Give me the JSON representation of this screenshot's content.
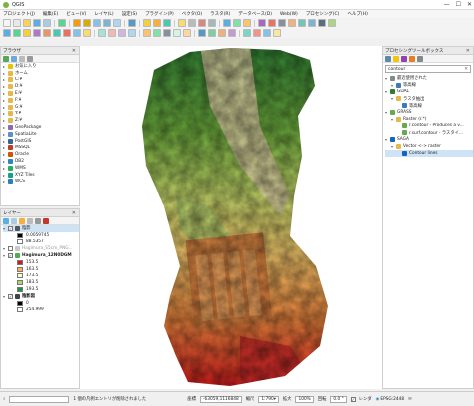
{
  "window": {
    "title": "QGIS"
  },
  "menu": [
    "プロジェクト(J)",
    "編集(E)",
    "ビュー(V)",
    "レイヤ(L)",
    "設定(S)",
    "プラグイン(P)",
    "ベクタ(O)",
    "ラスタ(R)",
    "データベース(D)",
    "Web(W)",
    "プロセシング(C)",
    "ヘルプ(H)"
  ],
  "browser": {
    "title": "ブラウザ",
    "items": [
      {
        "label": "お気に入り",
        "icon": "star-icon",
        "color": "#e8c400",
        "indent": 0
      },
      {
        "label": "ホーム",
        "icon": "folder-icon",
        "color": "#e6b84a",
        "indent": 0
      },
      {
        "label": "C:¥",
        "icon": "folder-icon",
        "color": "#e6b84a",
        "indent": 0
      },
      {
        "label": "D:¥",
        "icon": "folder-icon",
        "color": "#e6b84a",
        "indent": 0
      },
      {
        "label": "E:¥",
        "icon": "folder-icon",
        "color": "#e6b84a",
        "indent": 0
      },
      {
        "label": "F:¥",
        "icon": "folder-icon",
        "color": "#e6b84a",
        "indent": 0
      },
      {
        "label": "G:¥",
        "icon": "folder-icon",
        "color": "#e6b84a",
        "indent": 0
      },
      {
        "label": "Y:¥",
        "icon": "folder-icon",
        "color": "#e6b84a",
        "indent": 0
      },
      {
        "label": "Z:¥",
        "icon": "folder-icon",
        "color": "#e6b84a",
        "indent": 0
      },
      {
        "label": "GeoPackage",
        "icon": "geopackage-icon",
        "color": "#8c6bb1",
        "indent": 0
      },
      {
        "label": "SpatiaLite",
        "icon": "spatialite-icon",
        "color": "#5b8fd0",
        "indent": 0
      },
      {
        "label": "PostGIS",
        "icon": "postgis-icon",
        "color": "#336791",
        "indent": 0
      },
      {
        "label": "MSSQL",
        "icon": "mssql-icon",
        "color": "#c0392b",
        "indent": 0
      },
      {
        "label": "Oracle",
        "icon": "oracle-icon",
        "color": "#d35400",
        "indent": 0
      },
      {
        "label": "DB2",
        "icon": "db2-icon",
        "color": "#2e86c1",
        "indent": 0
      },
      {
        "label": "WMS",
        "icon": "wms-icon",
        "color": "#27ae60",
        "indent": 0
      },
      {
        "label": "XYZ Tiles",
        "icon": "xyz-tiles-icon",
        "color": "#16a085",
        "indent": 0
      },
      {
        "label": "WCS",
        "icon": "wcs-icon",
        "color": "#2980b9",
        "indent": 0
      }
    ]
  },
  "layers": {
    "title": "レイヤー",
    "items": [
      {
        "type": "layer",
        "label": "陰影",
        "checked": true,
        "color": "#555555",
        "selected": true
      },
      {
        "type": "legend",
        "label": "0.0059745",
        "color": "#000000"
      },
      {
        "type": "legend",
        "label": "88.5357",
        "color": "#ffffff"
      },
      {
        "type": "layer",
        "label": "Hagimura_S5cm_PNG...",
        "checked": false,
        "color": "#c8c8c8",
        "muted": true
      },
      {
        "type": "layer",
        "label": "Hagimura_12N0DGM",
        "checked": true,
        "color": "#4caf50",
        "bold": true
      },
      {
        "type": "legend",
        "label": "153.5",
        "color": "#d7191c"
      },
      {
        "type": "legend",
        "label": "163.5",
        "color": "#fdae61"
      },
      {
        "type": "legend",
        "label": "173.5",
        "color": "#ffffbf"
      },
      {
        "type": "legend",
        "label": "183.5",
        "color": "#a6d96a"
      },
      {
        "type": "legend",
        "label": "193.5",
        "color": "#1a9641"
      },
      {
        "type": "layer",
        "label": "陰影図",
        "checked": true,
        "color": "#444444",
        "bold": true
      },
      {
        "type": "legend",
        "label": "0",
        "color": "#000000"
      },
      {
        "type": "legend",
        "label": "254.999",
        "color": "#ffffff"
      }
    ]
  },
  "processing": {
    "title": "プロセシングツールボックス",
    "search_value": "contour",
    "items": [
      {
        "label": "最近使用された",
        "indent": 0,
        "icon": "clock-icon",
        "color": "#7f8c8d"
      },
      {
        "label": "等高線",
        "indent": 1,
        "icon": "algorithm-icon",
        "color": "#3e7ab8"
      },
      {
        "label": "GDAL",
        "indent": 0,
        "icon": "gdal-icon",
        "color": "#2e7d32"
      },
      {
        "label": "ラスタ抽出",
        "indent": 1,
        "icon": "folder-icon",
        "color": "#e6b84a"
      },
      {
        "label": "等高線",
        "indent": 2,
        "icon": "algorithm-icon",
        "color": "#3e7ab8"
      },
      {
        "label": "GRASS",
        "indent": 0,
        "icon": "grass-icon",
        "color": "#6aa84f"
      },
      {
        "label": "Raster (r.*)",
        "indent": 1,
        "icon": "folder-icon",
        "color": "#e6b84a"
      },
      {
        "label": "r.contour - Produces a v...",
        "indent": 2,
        "icon": "grass-icon",
        "color": "#6aa84f"
      },
      {
        "label": "r.surf.contour - ラスタイ...",
        "indent": 2,
        "icon": "grass-icon",
        "color": "#6aa84f"
      },
      {
        "label": "SAGA",
        "indent": 0,
        "icon": "saga-icon",
        "color": "#1565c0"
      },
      {
        "label": "Vector <-> raster",
        "indent": 1,
        "icon": "folder-icon",
        "color": "#e6b84a"
      },
      {
        "label": "Contour lines",
        "indent": 2,
        "icon": "saga-icon",
        "color": "#1565c0",
        "selected": true
      }
    ]
  },
  "status": {
    "message": "1 個の凡例エントリが削除されました",
    "coord_label": "座標",
    "coord_value": "-63059,1116848",
    "scale_label": "縮尺",
    "scale_value": "1:790",
    "magnifier_label": "拡大",
    "magnifier_value": "100%",
    "rotation_label": "回転",
    "rotation_value": "0.0 °",
    "render_label": "レンダ",
    "crs": "EPSG:2448"
  }
}
